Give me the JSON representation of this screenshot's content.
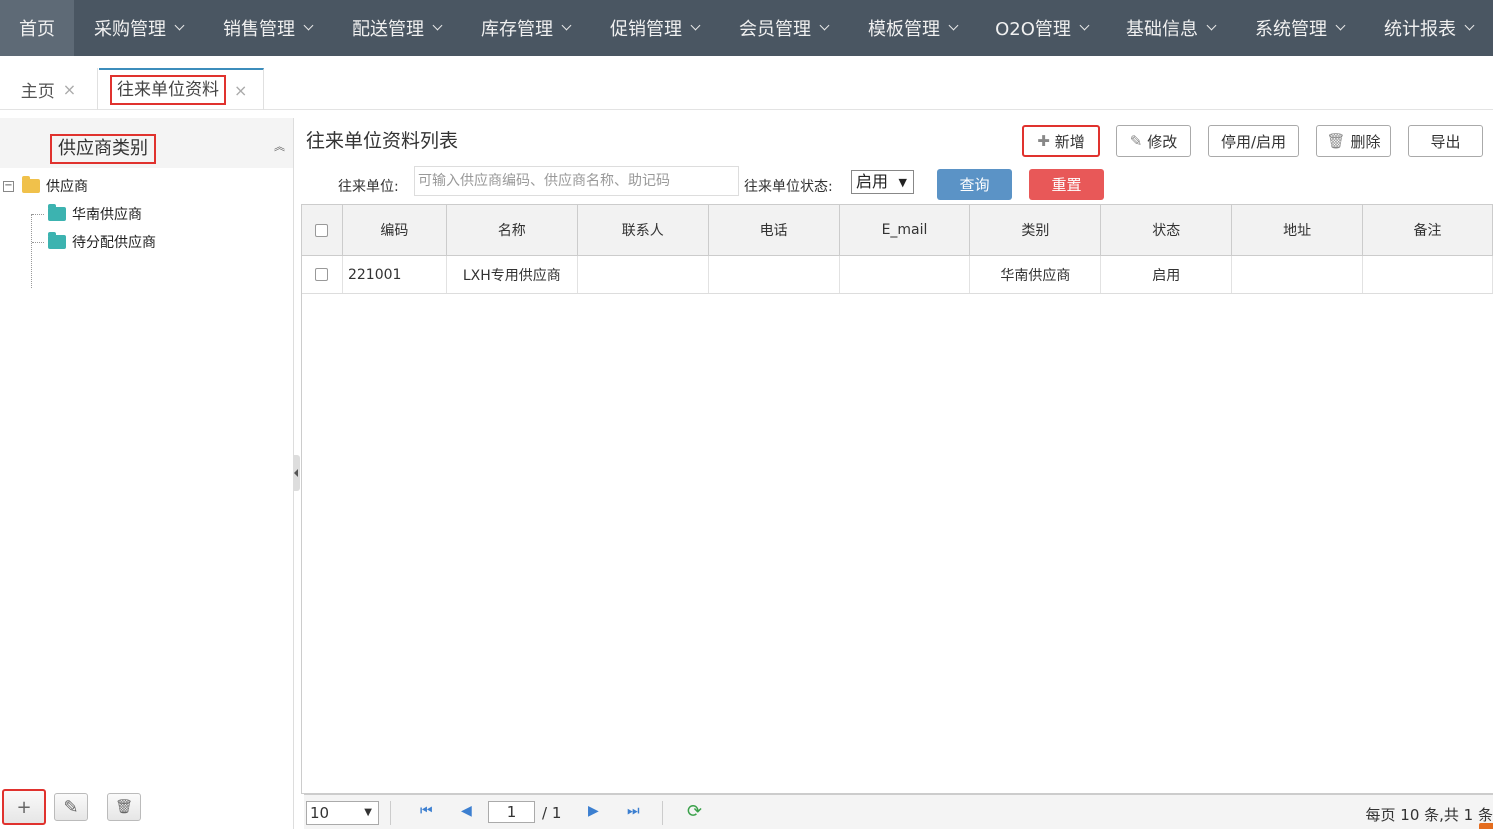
{
  "nav": {
    "items": [
      {
        "label": "首页"
      },
      {
        "label": "采购管理"
      },
      {
        "label": "销售管理"
      },
      {
        "label": "配送管理"
      },
      {
        "label": "库存管理"
      },
      {
        "label": "促销管理"
      },
      {
        "label": "会员管理"
      },
      {
        "label": "模板管理"
      },
      {
        "label": "O2O管理"
      },
      {
        "label": "基础信息"
      },
      {
        "label": "系统管理"
      },
      {
        "label": "统计报表"
      }
    ]
  },
  "tabs": {
    "home": "主页",
    "active": "往来单位资料",
    "close": "×"
  },
  "left": {
    "title": "供应商类别",
    "collapse": "︽",
    "tree": {
      "root": "供应商",
      "children": [
        "华南供应商",
        "待分配供应商"
      ]
    },
    "buttons": {
      "add": "+",
      "edit": "✎",
      "delete": "🗑"
    }
  },
  "main": {
    "title": "往来单位资料列表",
    "toolbar": {
      "add": "新增",
      "edit": "修改",
      "toggle": "停用/启用",
      "delete": "删除",
      "export": "导出"
    },
    "search": {
      "unit_label": "往来单位:",
      "unit_placeholder": "可输入供应商编码、供应商名称、助记码",
      "status_label": "往来单位状态:",
      "status_value": "启用",
      "query": "查询",
      "reset": "重置"
    },
    "table": {
      "columns": [
        "编码",
        "名称",
        "联系人",
        "电话",
        "E_mail",
        "类别",
        "状态",
        "地址",
        "备注"
      ],
      "rows": [
        {
          "code": "221001",
          "name": "LXH专用供应商",
          "contact": "",
          "phone": "",
          "email": "",
          "category": "华南供应商",
          "status": "启用",
          "address": "",
          "note": ""
        }
      ]
    },
    "pager": {
      "page_size": "10",
      "page": "1",
      "total_pages": "/ 1",
      "info": "每页 10 条,共 1 条"
    }
  }
}
